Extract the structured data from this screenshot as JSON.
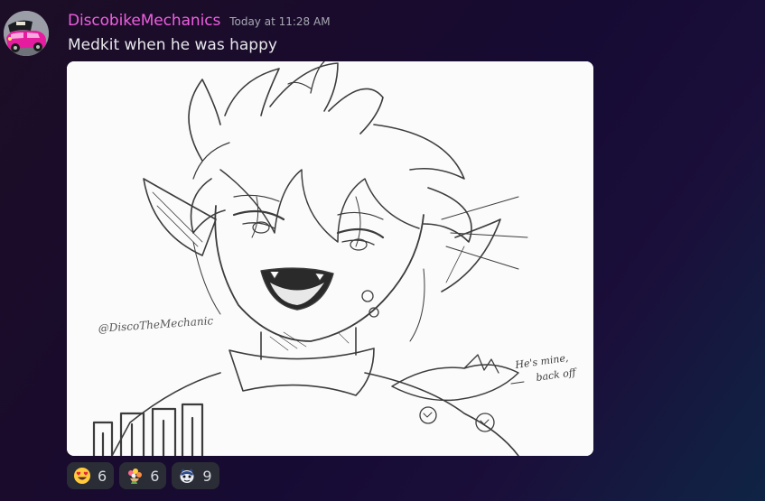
{
  "message": {
    "author": "DiscobikeMechanics",
    "timestamp": "Today at 11:28 AM",
    "text": "Medkit when he was happy",
    "author_color": "#f05ee0",
    "attachment": {
      "kind": "sketch-image",
      "signature": "@DiscoTheMechanic",
      "handwritten_note": "He's mine, back off"
    },
    "reactions": [
      {
        "icon": "heart-eyes-emoji-icon",
        "count": "6"
      },
      {
        "icon": "bouquet-emoji-icon",
        "count": "6"
      },
      {
        "icon": "custom-creature-emoji-icon",
        "count": "9"
      }
    ]
  }
}
